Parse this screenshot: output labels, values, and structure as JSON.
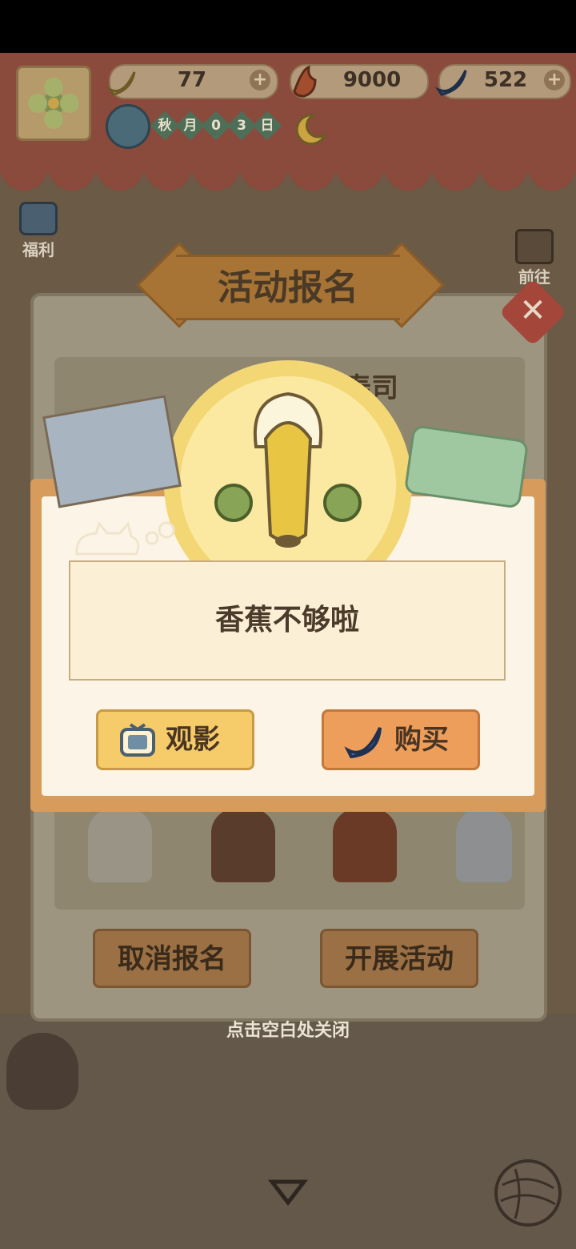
{
  "top_bar": {
    "bananas": "77",
    "coins": "9000",
    "premium": "522",
    "date_chars": [
      "秋",
      "月",
      "0",
      "3",
      "日"
    ]
  },
  "left_menu": {
    "welfare_label": "福利"
  },
  "right_menu": {
    "goto_label": "前往"
  },
  "back_panel": {
    "title": "活动报名",
    "card_title_fragment": "寿司",
    "cancel_label": "取消报名",
    "start_label": "开展活动"
  },
  "dialog": {
    "message": "香蕉不够啦",
    "watch_label": "观影",
    "buy_label": "购买"
  },
  "close_hint": "点击空白处关闭",
  "colors": {
    "dialog_border": "#d79b5c",
    "watch_button": "#f6cc6a",
    "buy_button": "#ee9e5b"
  }
}
